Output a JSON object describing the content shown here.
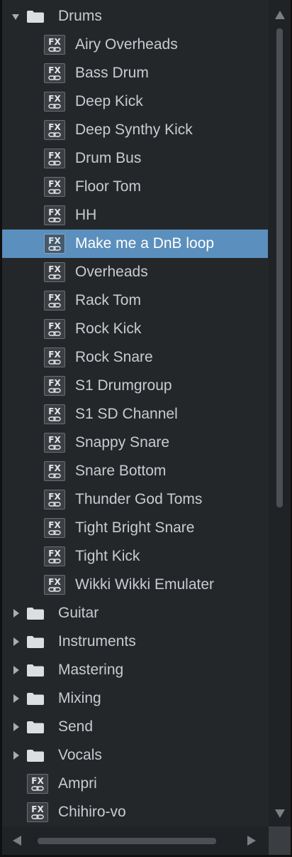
{
  "colors": {
    "panel_bg": "#24272a",
    "text": "#c8ccd0",
    "selected_bg": "#5b8fbd",
    "selected_text": "#ffffff"
  },
  "tree": {
    "items": [
      {
        "type": "folder",
        "label": "Drums",
        "expanded": true,
        "depth": 0
      },
      {
        "type": "fx",
        "label": "Airy Overheads",
        "depth": 1
      },
      {
        "type": "fx",
        "label": "Bass Drum",
        "depth": 1
      },
      {
        "type": "fx",
        "label": "Deep Kick",
        "depth": 1
      },
      {
        "type": "fx",
        "label": "Deep Synthy Kick",
        "depth": 1
      },
      {
        "type": "fx",
        "label": "Drum Bus",
        "depth": 1
      },
      {
        "type": "fx",
        "label": "Floor Tom",
        "depth": 1
      },
      {
        "type": "fx",
        "label": "HH",
        "depth": 1
      },
      {
        "type": "fx",
        "label": "Make me a DnB loop",
        "depth": 1,
        "selected": true
      },
      {
        "type": "fx",
        "label": "Overheads",
        "depth": 1
      },
      {
        "type": "fx",
        "label": "Rack Tom",
        "depth": 1
      },
      {
        "type": "fx",
        "label": "Rock Kick",
        "depth": 1
      },
      {
        "type": "fx",
        "label": "Rock Snare",
        "depth": 1
      },
      {
        "type": "fx",
        "label": "S1 Drumgroup",
        "depth": 1
      },
      {
        "type": "fx",
        "label": "S1 SD Channel",
        "depth": 1
      },
      {
        "type": "fx",
        "label": "Snappy Snare",
        "depth": 1
      },
      {
        "type": "fx",
        "label": "Snare Bottom",
        "depth": 1
      },
      {
        "type": "fx",
        "label": "Thunder God Toms",
        "depth": 1
      },
      {
        "type": "fx",
        "label": "Tight Bright Snare",
        "depth": 1
      },
      {
        "type": "fx",
        "label": "Tight Kick",
        "depth": 1
      },
      {
        "type": "fx",
        "label": "Wikki Wikki Emulater",
        "depth": 1
      },
      {
        "type": "folder",
        "label": "Guitar",
        "expanded": false,
        "depth": 0
      },
      {
        "type": "folder",
        "label": "Instruments",
        "expanded": false,
        "depth": 0
      },
      {
        "type": "folder",
        "label": "Mastering",
        "expanded": false,
        "depth": 0
      },
      {
        "type": "folder",
        "label": "Mixing",
        "expanded": false,
        "depth": 0
      },
      {
        "type": "folder",
        "label": "Send",
        "expanded": false,
        "depth": 0
      },
      {
        "type": "folder",
        "label": "Vocals",
        "expanded": false,
        "depth": 0
      },
      {
        "type": "fx",
        "label": "Ampri",
        "depth": 0
      },
      {
        "type": "fx",
        "label": "Chihiro-vo",
        "depth": 0
      }
    ]
  },
  "icons": {
    "folder": "folder-icon",
    "fx": "fx-preset-icon",
    "expanded": "triangle-down-icon",
    "collapsed": "triangle-right-icon",
    "fx_badge_text": "FX"
  }
}
